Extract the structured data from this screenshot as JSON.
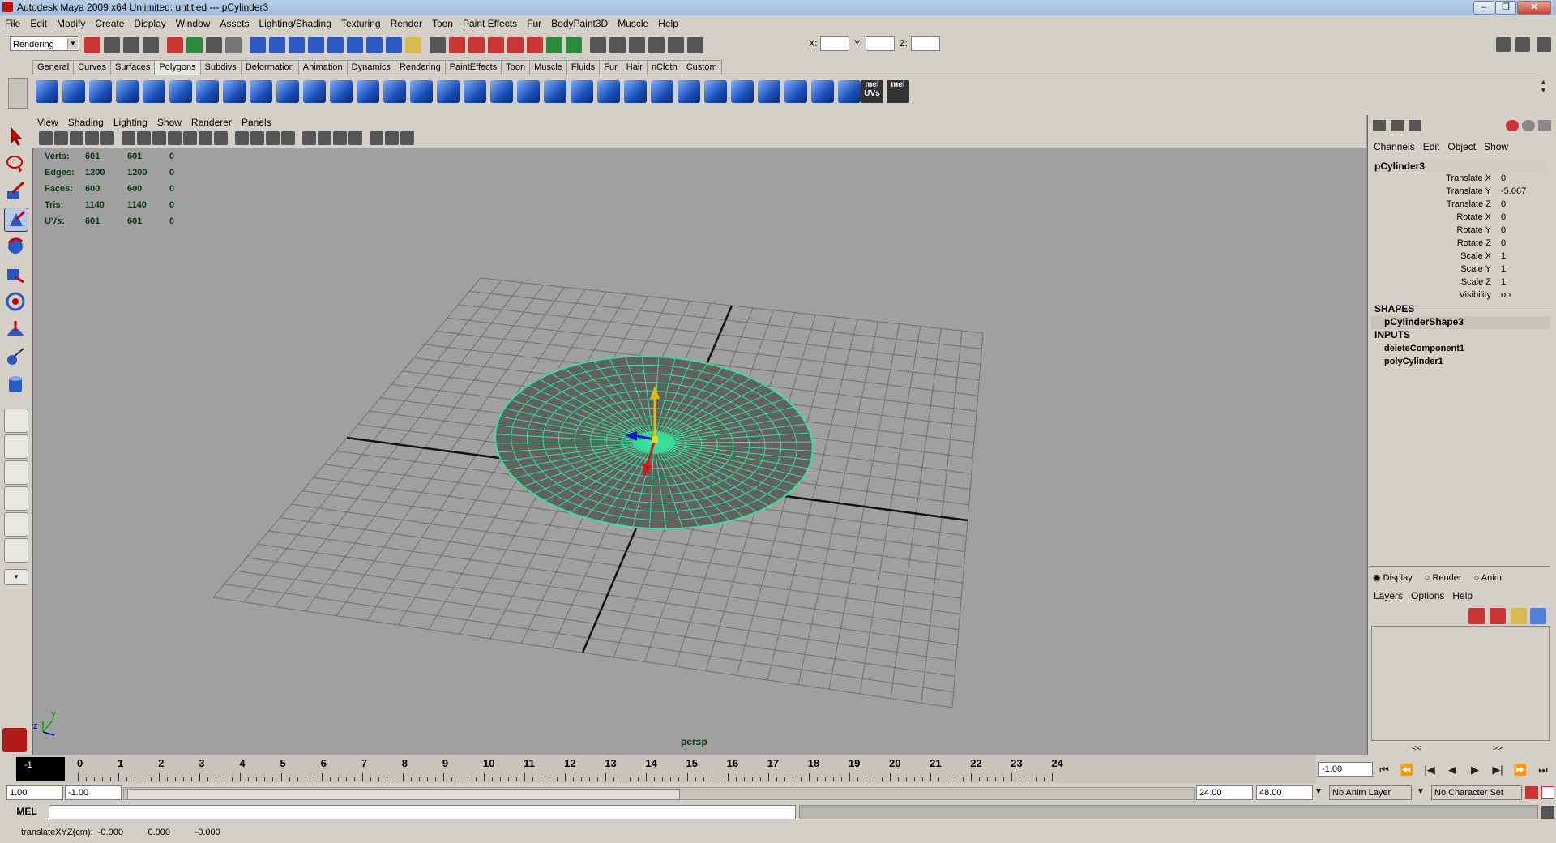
{
  "window": {
    "title": "Autodesk Maya 2009 x64 Unlimited: untitled    ---    pCylinder3"
  },
  "menu": [
    "File",
    "Edit",
    "Modify",
    "Create",
    "Display",
    "Window",
    "Assets",
    "Lighting/Shading",
    "Texturing",
    "Render",
    "Toon",
    "Paint Effects",
    "Fur",
    "BodyPaint3D",
    "Muscle",
    "Help"
  ],
  "statusline": {
    "menuset": "Rendering",
    "x_label": "X:",
    "y_label": "Y:",
    "z_label": "Z:"
  },
  "shelf_tabs": [
    "General",
    "Curves",
    "Surfaces",
    "Polygons",
    "Subdivs",
    "Deformation",
    "Animation",
    "Dynamics",
    "Rendering",
    "PaintEffects",
    "Toon",
    "Muscle",
    "Fluids",
    "Fur",
    "Hair",
    "nCloth",
    "Custom"
  ],
  "shelf_active": "Polygons",
  "shelf_icons": {
    "mel1": "mel",
    "uvs": "UVs",
    "mel2": "mel"
  },
  "viewport": {
    "menu": [
      "View",
      "Shading",
      "Lighting",
      "Show",
      "Renderer",
      "Panels"
    ],
    "camera": "persp",
    "hud": [
      {
        "label": "Verts:",
        "a": "601",
        "b": "601",
        "c": "0"
      },
      {
        "label": "Edges:",
        "a": "1200",
        "b": "1200",
        "c": "0"
      },
      {
        "label": "Faces:",
        "a": "600",
        "b": "600",
        "c": "0"
      },
      {
        "label": "Tris:",
        "a": "1140",
        "b": "1140",
        "c": "0"
      },
      {
        "label": "UVs:",
        "a": "601",
        "b": "601",
        "c": "0"
      }
    ],
    "axis_labels": {
      "y": "y",
      "z": "z"
    },
    "colors": {
      "mesh": "#3adf9a",
      "background": "#a0a0a0"
    }
  },
  "channelbox": {
    "menu": [
      "Channels",
      "Edit",
      "Object",
      "Show"
    ],
    "object": "pCylinder3",
    "channels": [
      {
        "name": "Translate X",
        "value": "0"
      },
      {
        "name": "Translate Y",
        "value": "-5.067"
      },
      {
        "name": "Translate Z",
        "value": "0"
      },
      {
        "name": "Rotate X",
        "value": "0"
      },
      {
        "name": "Rotate Y",
        "value": "0"
      },
      {
        "name": "Rotate Z",
        "value": "0"
      },
      {
        "name": "Scale X",
        "value": "1"
      },
      {
        "name": "Scale Y",
        "value": "1"
      },
      {
        "name": "Scale Z",
        "value": "1"
      },
      {
        "name": "Visibility",
        "value": "on"
      }
    ],
    "shapes_header": "SHAPES",
    "shape": "pCylinderShape3",
    "inputs_header": "INPUTS",
    "inputs": [
      "deleteComponent1",
      "polyCylinder1"
    ]
  },
  "layers": {
    "modes": [
      "Display",
      "Render",
      "Anim"
    ],
    "menu": [
      "Layers",
      "Options",
      "Help"
    ],
    "scroll_left": "<<",
    "scroll_right": ">>"
  },
  "timeline": {
    "ticks": [
      "0",
      "1",
      "2",
      "3",
      "4",
      "5",
      "6",
      "7",
      "8",
      "9",
      "10",
      "11",
      "12",
      "13",
      "14",
      "15",
      "16",
      "17",
      "18",
      "19",
      "20",
      "21",
      "22",
      "23",
      "24"
    ],
    "current_frame": "-1",
    "current_field": "-1.00"
  },
  "range": {
    "start": "1.00",
    "playback_start": "-1.00",
    "playback_end": "24.00",
    "end": "48.00",
    "anim_layer": "No Anim Layer",
    "char_set": "No Character Set"
  },
  "command": {
    "label": "MEL"
  },
  "helpline": {
    "text": "translateXYZ(cm):  -0.000          0.000          -0.000"
  }
}
